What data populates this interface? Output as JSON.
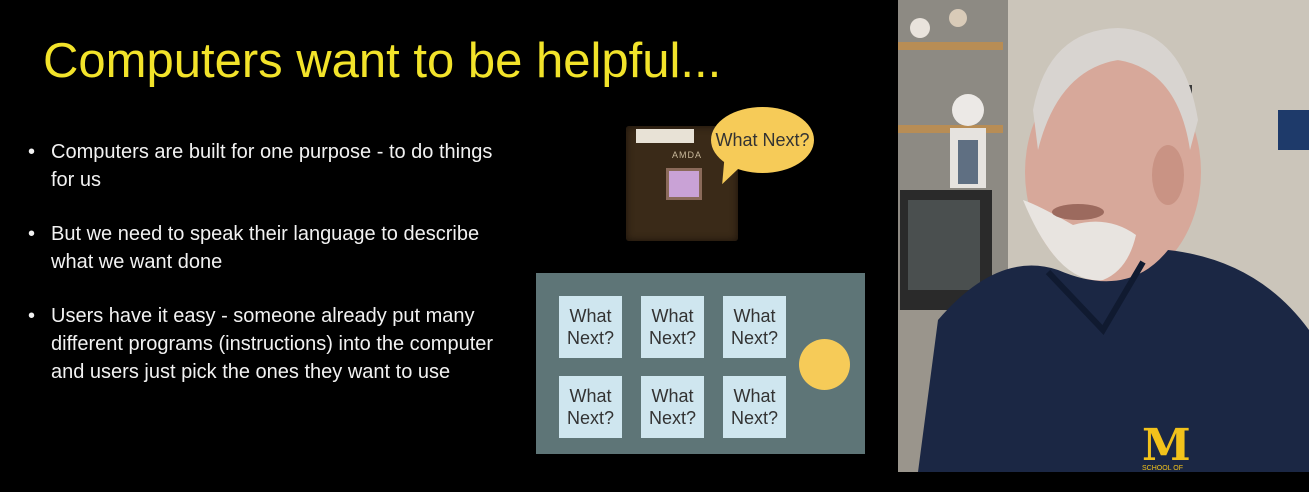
{
  "slide": {
    "title": "Computers want to be helpful...",
    "bullet_char": "•",
    "bullets": [
      "Computers are built for one purpose - to do things for us",
      "But we need to speak their language to describe what we want done",
      "Users have it easy - someone already put many different programs (instructions) into the computer and users just pick the ones they want to use"
    ],
    "chip_label": "AMDA",
    "bubble_text": "What Next?",
    "tiles": [
      "What Next?",
      "What Next?",
      "What Next?",
      "What Next?",
      "What Next?",
      "What Next?"
    ]
  },
  "video": {
    "shirt_logo": "M",
    "shirt_text": "SCHOOL OF"
  },
  "colors": {
    "title": "#f2e32a",
    "bubble": "#f6cb58",
    "board": "#5e7577",
    "tile": "#cfe6ef",
    "shirt": "#1b2744",
    "logo": "#f2c21b"
  }
}
